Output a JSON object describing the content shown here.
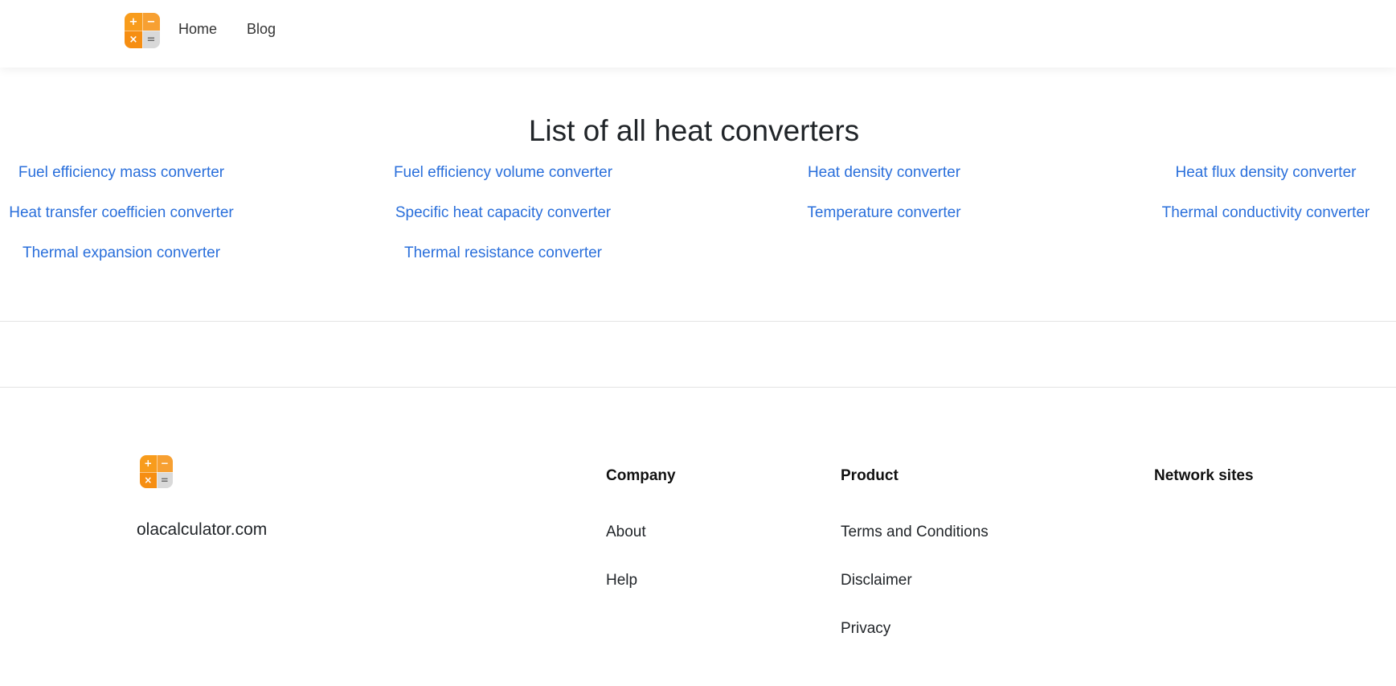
{
  "header": {
    "logo_icon": "calculator-logo-icon",
    "nav": [
      {
        "label": "Home"
      },
      {
        "label": "Blog"
      }
    ]
  },
  "main": {
    "title": "List of all heat converters",
    "converters": [
      "Fuel efficiency mass converter",
      "Fuel efficiency volume converter",
      "Heat density converter",
      "Heat flux density converter",
      "Heat transfer coefficien converter",
      "Specific heat capacity converter",
      "Temperature converter",
      "Thermal conductivity converter",
      "Thermal expansion converter",
      "Thermal resistance converter"
    ],
    "link_color": "#2a6fdb"
  },
  "logo_glyphs": {
    "plus": "+",
    "minus": "−",
    "times": "×",
    "equals": "="
  },
  "logo_colors": {
    "orange": "#f89c1c",
    "grey": "#d9d9d9"
  },
  "footer": {
    "site_name": "olacalculator.com",
    "columns": [
      {
        "heading": "Company",
        "links": [
          "About",
          "Help"
        ]
      },
      {
        "heading": "Product",
        "links": [
          "Terms and Conditions",
          "Disclaimer",
          "Privacy"
        ]
      },
      {
        "heading": "Network sites",
        "links": []
      }
    ]
  }
}
